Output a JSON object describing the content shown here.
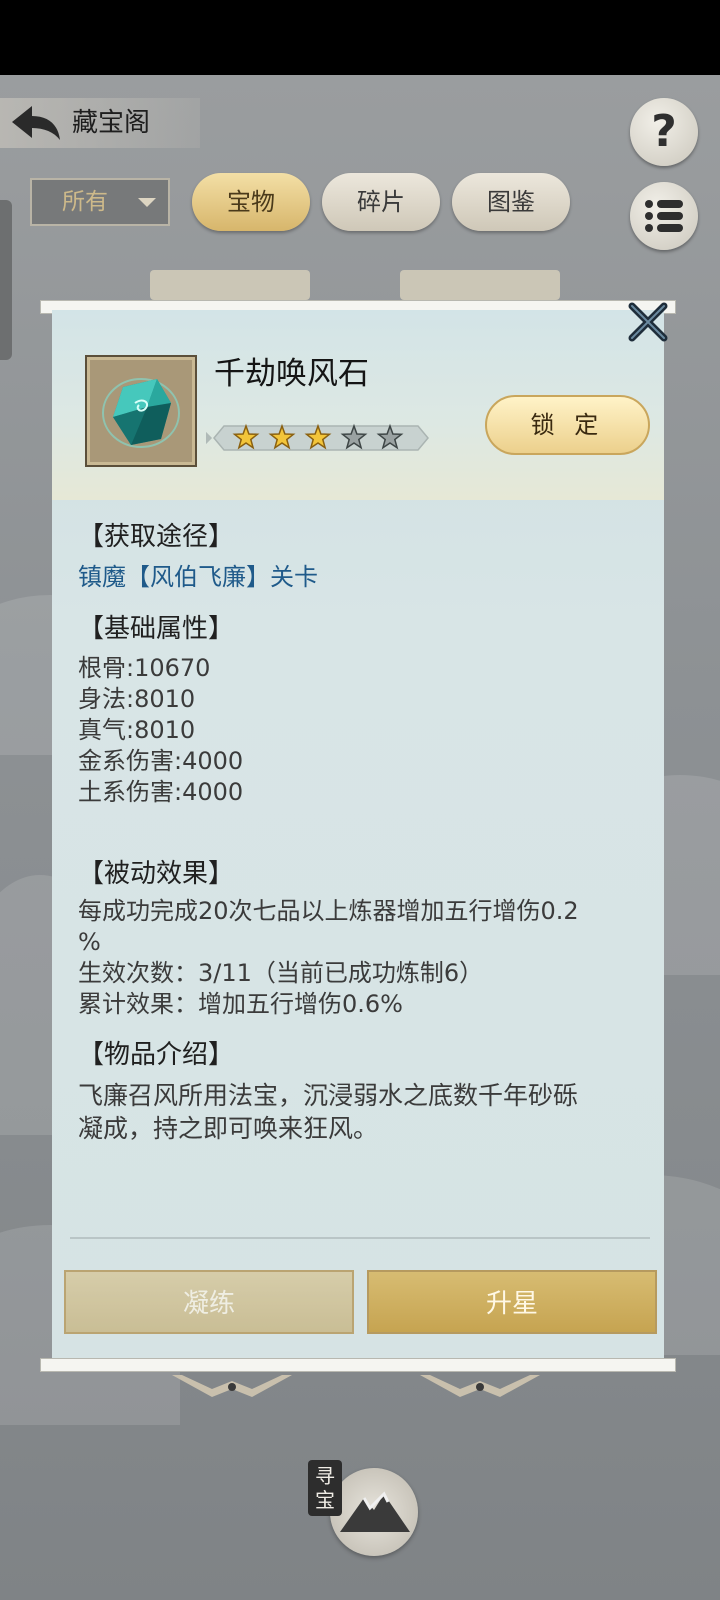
{
  "header": {
    "title": "藏宝阁",
    "help_label": "?"
  },
  "filter": {
    "selected": "所有"
  },
  "tabs": [
    {
      "label": "宝物",
      "active": true
    },
    {
      "label": "碎片",
      "active": false
    },
    {
      "label": "图鉴",
      "active": false
    }
  ],
  "item": {
    "name": "千劫唤风石",
    "stars": 3,
    "max_stars": 5,
    "lock_label": "锁 定"
  },
  "sections": {
    "source_head": "【获取途径】",
    "source_text": "镇魔【风伯飞廉】关卡",
    "base_head": "【基础属性】",
    "base_stats": [
      "根骨:10670",
      "身法:8010",
      "真气:8010",
      "金系伤害:4000",
      "土系伤害:4000"
    ],
    "passive_head": "【被动效果】",
    "passive_lines": [
      "每成功完成20次七品以上炼器增加五行增伤0.2",
      "%",
      "生效次数：3/11（当前已成功炼制6）",
      "累计效果：增加五行增伤0.6%"
    ],
    "intro_head": "【物品介绍】",
    "intro_lines": [
      "飞廉召风所用法宝，沉浸弱水之底数千年砂砾",
      "凝成，持之即可唤来狂风。"
    ]
  },
  "actions": {
    "refine_label": "凝练",
    "upgrade_label": "升星"
  },
  "bottom": {
    "treasure_label": "寻宝"
  },
  "colors": {
    "accent_gold": "#d7bc72",
    "link_blue": "#1f5a8a",
    "panel_bg": "#d8e5e6"
  }
}
